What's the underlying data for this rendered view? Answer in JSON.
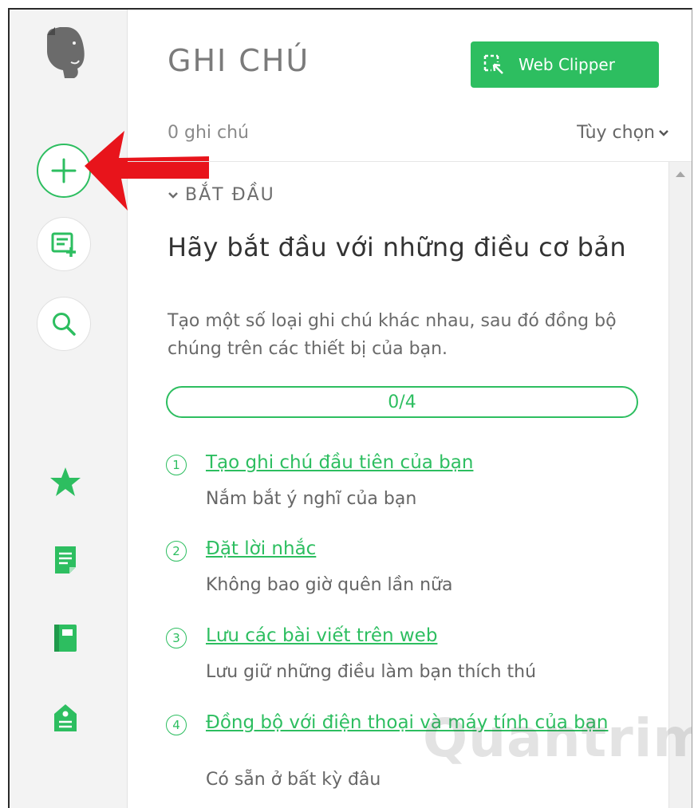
{
  "header": {
    "title": "GHI CHÚ",
    "web_clipper_label": "Web Clipper",
    "note_count": "0 ghi chú",
    "options_label": "Tùy chọn"
  },
  "sidebar": {
    "icons": [
      "evernote-elephant-logo",
      "plus-icon",
      "note-plus-icon",
      "search-icon",
      "star-icon",
      "notes-icon",
      "notebook-icon",
      "tag-icon"
    ]
  },
  "section": {
    "label": "BẮT ĐẦU",
    "headline": "Hãy bắt đầu với những điều cơ bản",
    "description": "Tạo một số loại ghi chú khác nhau, sau đó đồng bộ chúng trên các thiết bị của bạn.",
    "progress_text": "0/4",
    "progress_value": 0
  },
  "tasks": [
    {
      "number": "1",
      "title": "Tạo ghi chú đầu tiên của bạn",
      "description": "Nắm bắt ý nghĩ của bạn"
    },
    {
      "number": "2",
      "title": "Đặt lời nhắc",
      "description": "Không bao giờ quên lần nữa"
    },
    {
      "number": "3",
      "title": "Lưu các bài viết trên web",
      "description": "Lưu giữ những điều làm bạn thích thú"
    },
    {
      "number": "4",
      "title": "Đồng bộ với điện thoại và máy tính của bạn",
      "description": "Có sẵn ở bất kỳ đâu"
    }
  ],
  "watermark": "Quantrimang",
  "colors": {
    "accent": "#2dbe60",
    "arrow": "#e8141b",
    "sidebar_bg": "#f3f3f3",
    "logo": "#6b6b6b"
  }
}
